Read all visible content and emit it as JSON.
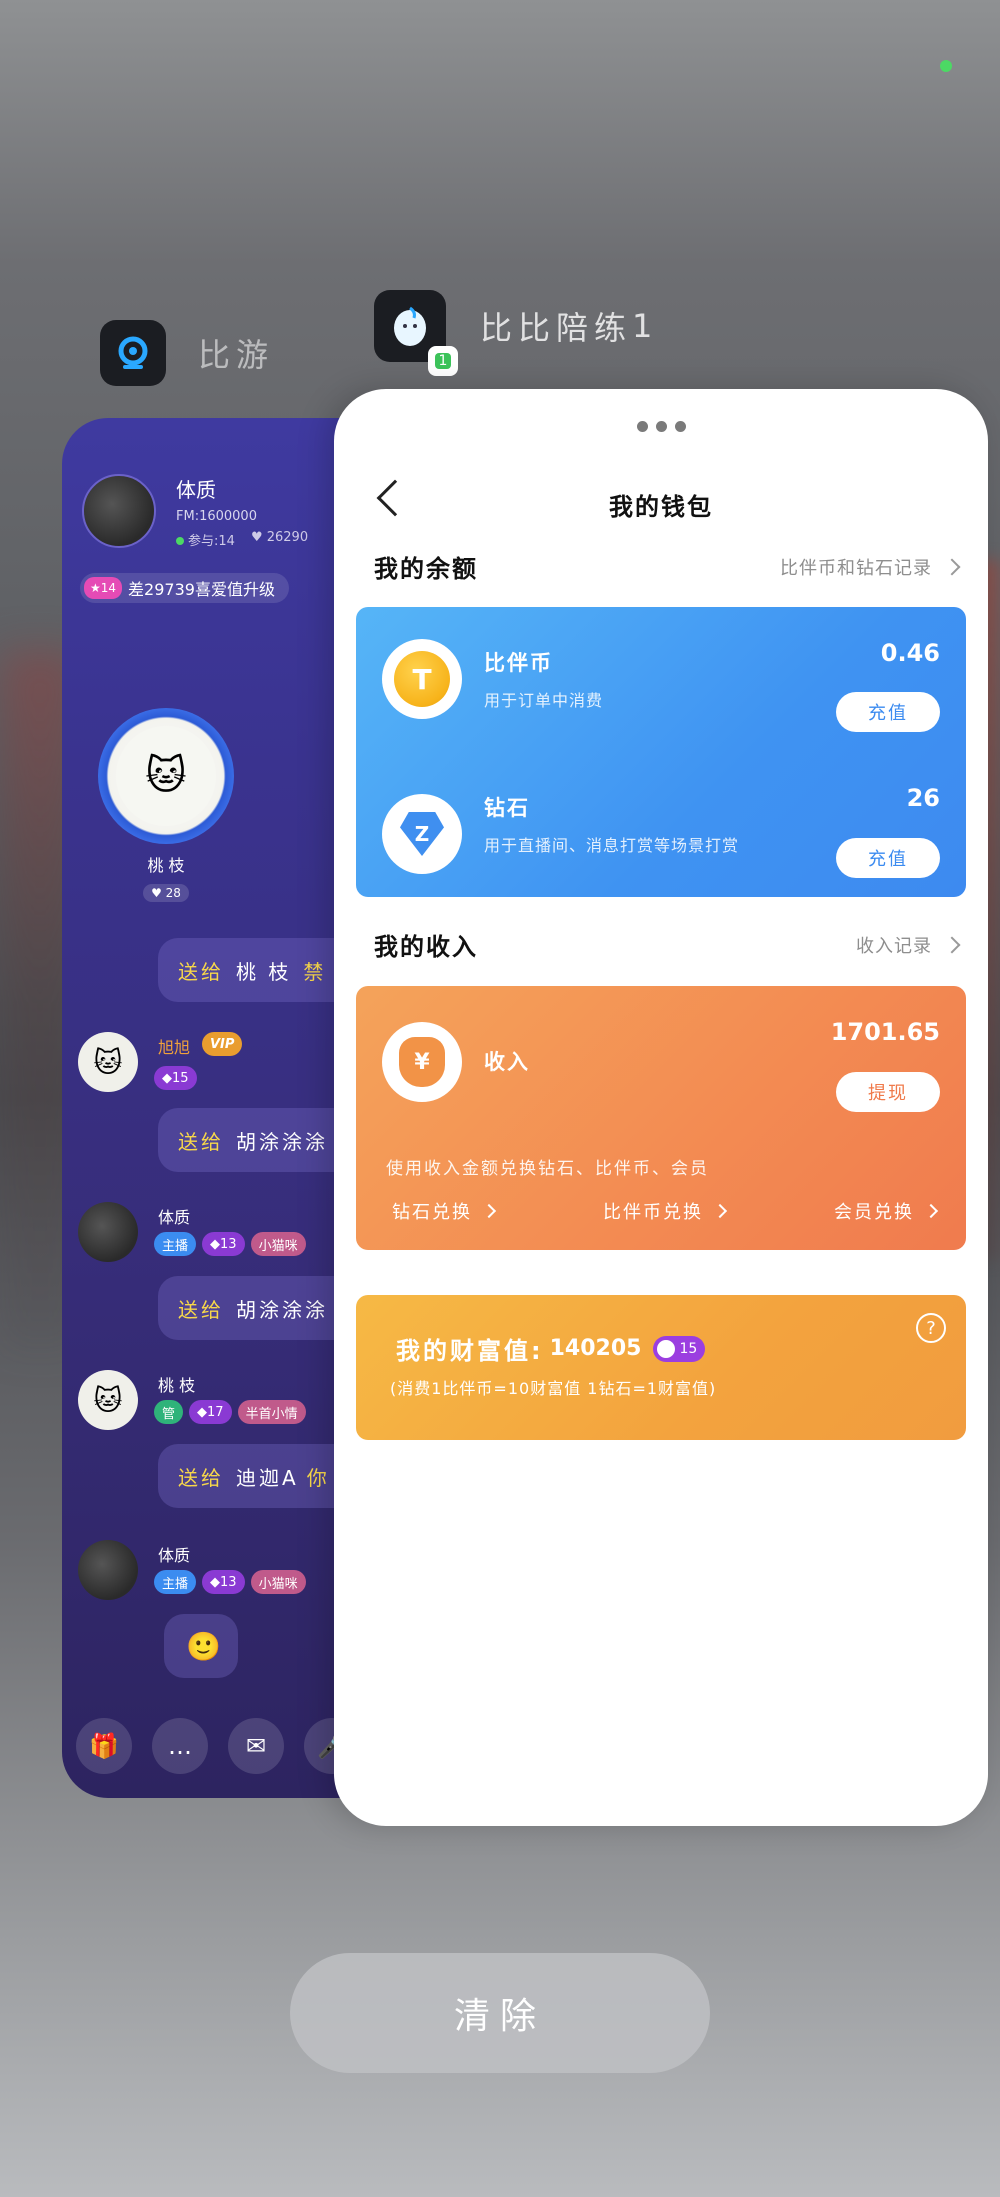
{
  "app_left": {
    "name": "比游",
    "header": {
      "name": "体质",
      "fm": "FM:1600000",
      "participants": "参与:14",
      "hearts": "26290"
    },
    "upgrade": {
      "level": "14",
      "text": "差29739喜爱值升级"
    },
    "seat": {
      "name": "桃 枝",
      "hearts": "28"
    },
    "messages": [
      {
        "text_gift": "送给",
        "text_target": "桃 枝",
        "text_extra": "禁"
      },
      {
        "name": "旭旭",
        "vip": "VIP",
        "level": "15",
        "text_gift": "送给",
        "text_target": "胡涂涂涂"
      },
      {
        "name": "体质",
        "tags": [
          "主播",
          "13",
          "小猫咪"
        ],
        "text_gift": "送给",
        "text_target": "胡涂涂涂"
      },
      {
        "name": "桃 枝",
        "tags": [
          "管",
          "17",
          "半首小情"
        ],
        "text_gift": "送给",
        "text_target": "迪迦A",
        "text_extra": "你"
      },
      {
        "name": "体质",
        "tags": [
          "主播",
          "13",
          "小猫咪"
        ]
      }
    ]
  },
  "app_right": {
    "name": "比比陪练",
    "badge": "1",
    "page_title": "我的钱包",
    "balance_section": {
      "title": "我的余额",
      "link": "比伴币和钻石记录"
    },
    "coin": {
      "icon_letter": "T",
      "label": "比伴币",
      "desc": "用于订单中消费",
      "amount": "0.46",
      "button": "充值"
    },
    "diamond": {
      "icon_letter": "Z",
      "label": "钻石",
      "desc": "用于直播间、消息打赏等场景打赏",
      "amount": "26",
      "button": "充值"
    },
    "income_section": {
      "title": "我的收入",
      "link": "收入记录"
    },
    "income": {
      "icon_symbol": "¥",
      "label": "收入",
      "amount": "1701.65",
      "button": "提现",
      "note": "使用收入金额兑换钻石、比伴币、会员",
      "links": [
        "钻石兑换",
        "比伴币兑换",
        "会员兑换"
      ]
    },
    "wealth": {
      "label": "我的财富值:",
      "value": "140205",
      "level": "15",
      "formula": "(消费1比伴币=10财富值 1钻石=1财富值)",
      "help": "?"
    }
  },
  "clear_button": "清除"
}
